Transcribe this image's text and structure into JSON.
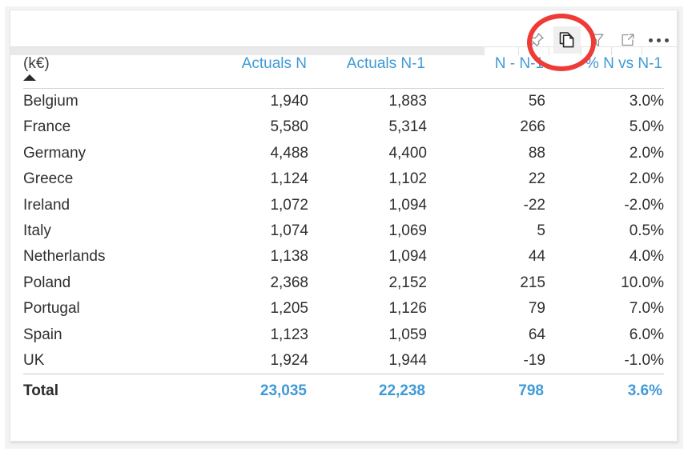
{
  "visual": {
    "title": "",
    "toolbar": {
      "icons": [
        {
          "name": "pin-icon",
          "label": "Pin to a dashboard"
        },
        {
          "name": "copy-icon",
          "label": "Copy visual as image"
        },
        {
          "name": "filter-icon",
          "label": "Filters"
        },
        {
          "name": "focus-mode-icon",
          "label": "Focus mode"
        },
        {
          "name": "more-options-icon",
          "label": "More options"
        }
      ],
      "highlighted_icon": "copy-icon"
    }
  },
  "colors": {
    "header_blue": "#3f9ad6",
    "total_blue": "#3f9ad6",
    "negative_red": "#e8716c",
    "body_text": "#2f2f2f",
    "annotation_red": "#ee3b37",
    "card_border": "#e6e6e6",
    "band_grey": "#e9e9e9"
  },
  "table": {
    "sort": {
      "column": "(k€)",
      "direction": "ascending",
      "glyph": "caret-up-icon"
    },
    "columns": [
      {
        "key": "category",
        "label": "(k€)",
        "align": "left"
      },
      {
        "key": "actuals_n",
        "label": "Actuals N",
        "align": "right"
      },
      {
        "key": "actuals_n1",
        "label": "Actuals N-1",
        "align": "right"
      },
      {
        "key": "delta",
        "label": "N - N-1",
        "align": "right"
      },
      {
        "key": "pct",
        "label": "% N vs N-1",
        "align": "right"
      }
    ],
    "rows": [
      {
        "category": "Belgium",
        "actuals_n": "1,940",
        "actuals_n1": "1,883",
        "delta": "56",
        "pct": "3.0%",
        "delta_negative": false,
        "pct_negative": false
      },
      {
        "category": "France",
        "actuals_n": "5,580",
        "actuals_n1": "5,314",
        "delta": "266",
        "pct": "5.0%",
        "delta_negative": false,
        "pct_negative": false
      },
      {
        "category": "Germany",
        "actuals_n": "4,488",
        "actuals_n1": "4,400",
        "delta": "88",
        "pct": "2.0%",
        "delta_negative": false,
        "pct_negative": false
      },
      {
        "category": "Greece",
        "actuals_n": "1,124",
        "actuals_n1": "1,102",
        "delta": "22",
        "pct": "2.0%",
        "delta_negative": false,
        "pct_negative": false
      },
      {
        "category": "Ireland",
        "actuals_n": "1,072",
        "actuals_n1": "1,094",
        "delta": "-22",
        "pct": "-2.0%",
        "delta_negative": true,
        "pct_negative": true
      },
      {
        "category": "Italy",
        "actuals_n": "1,074",
        "actuals_n1": "1,069",
        "delta": "5",
        "pct": "0.5%",
        "delta_negative": false,
        "pct_negative": false
      },
      {
        "category": "Netherlands",
        "actuals_n": "1,138",
        "actuals_n1": "1,094",
        "delta": "44",
        "pct": "4.0%",
        "delta_negative": false,
        "pct_negative": false
      },
      {
        "category": "Poland",
        "actuals_n": "2,368",
        "actuals_n1": "2,152",
        "delta": "215",
        "pct": "10.0%",
        "delta_negative": false,
        "pct_negative": false
      },
      {
        "category": "Portugal",
        "actuals_n": "1,205",
        "actuals_n1": "1,126",
        "delta": "79",
        "pct": "7.0%",
        "delta_negative": false,
        "pct_negative": false
      },
      {
        "category": "Spain",
        "actuals_n": "1,123",
        "actuals_n1": "1,059",
        "delta": "64",
        "pct": "6.0%",
        "delta_negative": false,
        "pct_negative": false
      },
      {
        "category": "UK",
        "actuals_n": "1,924",
        "actuals_n1": "1,944",
        "delta": "-19",
        "pct": "-1.0%",
        "delta_negative": true,
        "pct_negative": true
      }
    ],
    "total": {
      "category": "Total",
      "actuals_n": "23,035",
      "actuals_n1": "22,238",
      "delta": "798",
      "pct": "3.6%"
    }
  }
}
